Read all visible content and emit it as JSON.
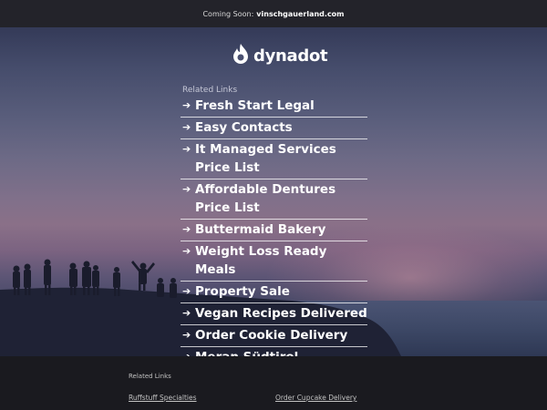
{
  "topbar": {
    "prefix": "Coming Soon:",
    "domain": "vinschgauerland.com"
  },
  "logo": {
    "text": "dynadot",
    "icon": "dynadot-flame-icon",
    "color": "#ffffff"
  },
  "related": {
    "heading": "Related Links",
    "arrow": "➔",
    "items": [
      "Fresh Start Legal",
      "Easy Contacts",
      "It Managed Services Price List",
      "Affordable Dentures Price List",
      "Buttermaid Bakery",
      "Weight Loss Ready Meals",
      "Property Sale",
      "Vegan Recipes Delivered",
      "Order Cookie Delivery",
      "Meran Südtirol"
    ]
  },
  "footer": {
    "heading": "Related Links",
    "links": [
      "Ruffstuff Specialties",
      "Order Cupcake Delivery"
    ]
  },
  "colors": {
    "topbar_bg": "#23232a",
    "footer_bg": "#1a1a1f",
    "link_text": "#ffffff",
    "sky_dusk": "#80708a"
  }
}
